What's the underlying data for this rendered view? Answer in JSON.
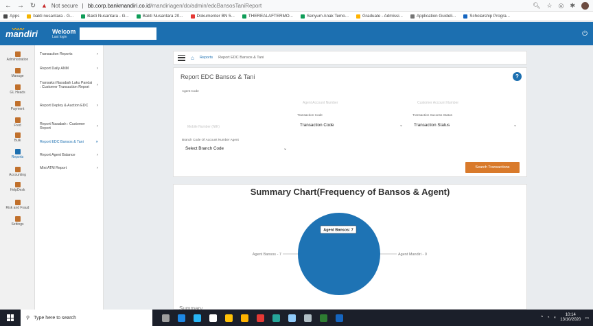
{
  "browser": {
    "not_secure": "Not secure",
    "url_host": "bb.corp.bankmandiri.co.id",
    "url_path": "/mandiriagen/do/admin/edcBansosTaniReport",
    "bookmarks": [
      "Apps",
      "bakti nusantara - G...",
      "Bakti Nusantara - G...",
      "Bakti Nusantara 20...",
      "Dokumenter BN 5...",
      "THEREALAFTERMO...",
      "Senyum Anak Temo...",
      "Graduate - Admissi...",
      "Application Guideli...",
      "Scholarship Progra..."
    ],
    "bookmark_colors": [
      "#4a4a4a",
      "#f4b400",
      "#0f9d58",
      "#0f9d58",
      "#e53935",
      "#0f9d58",
      "#0f9d58",
      "#ffb300",
      "#757575",
      "#1565c0"
    ]
  },
  "header": {
    "logo": "mandiri",
    "welcome": "Welcom",
    "last_login": "Last login"
  },
  "sidebar": {
    "icons": [
      {
        "label": "Administration"
      },
      {
        "label": "Manage"
      },
      {
        "label": "GL Heads"
      },
      {
        "label": "Payment"
      },
      {
        "label": "Fred"
      },
      {
        "label": "Bulk"
      },
      {
        "label": "Reports"
      },
      {
        "label": "Accounting"
      },
      {
        "label": "HelpDesk"
      },
      {
        "label": "Risk and Fraud"
      },
      {
        "label": "Settings"
      }
    ],
    "active_icon": "Reports",
    "submenu": [
      {
        "label": "Transaction Reports"
      },
      {
        "label": "Report Daily ANM"
      },
      {
        "label": "Transaksi Nasabah Laku Pandai : Customer Transaction Report"
      },
      {
        "label": "Report Deploy & Auction EDC"
      },
      {
        "label": "Report Nasabah : Customer Report"
      },
      {
        "label": "Report EDC Bansos & Tani"
      },
      {
        "label": "Report Agent Balance"
      },
      {
        "label": "Mini ATM Report"
      }
    ],
    "active_submenu": "Report EDC Bansos & Tani"
  },
  "breadcrumb": {
    "reports": "Reports",
    "current": "Report EDC Bansos & Tani"
  },
  "form": {
    "title": "Report EDC Bansos & Tani",
    "agent_code_label": "Agent Code",
    "agent_account_placeholder": "Agent Account Number",
    "customer_account_placeholder": "Customer Account Number",
    "transaction_code_label": "Transaction Code",
    "transaction_code_value": "Transaction Code",
    "transaction_status_label": "Transaction Success Status",
    "transaction_status_value": "Transaction Status",
    "mobile_placeholder": "Mobile Number (NIK)",
    "branch_label": "Branch Code Of Account Number Agent",
    "branch_value": "Select Branch Code",
    "search_button": "Search Transactions"
  },
  "chart_data": {
    "type": "pie",
    "title": "Summary Chart(Frequency of Bansos & Agent)",
    "labels": [
      "Agent Bansos",
      "Agent Mandiri"
    ],
    "values": [
      7,
      0
    ],
    "callout_labels": [
      "Agent Bansos - 7",
      "Agent Mandiri - 0"
    ],
    "tooltip": "Agent Bansos: 7",
    "colors": [
      "#1e73b4",
      "#1e73b4"
    ]
  },
  "summary_label": "Summary",
  "taskbar": {
    "search_placeholder": "Type here to search",
    "time": "10:14",
    "date": "13/10/2020",
    "app_colors": [
      "#9e9e9e",
      "#1e88e5",
      "#29b6f6",
      "#ffffff",
      "#ffc107",
      "#ffb300",
      "#e53935",
      "#26a69a",
      "#90caf9",
      "#b0bec5",
      "#2e7d32",
      "#1565c0"
    ]
  }
}
